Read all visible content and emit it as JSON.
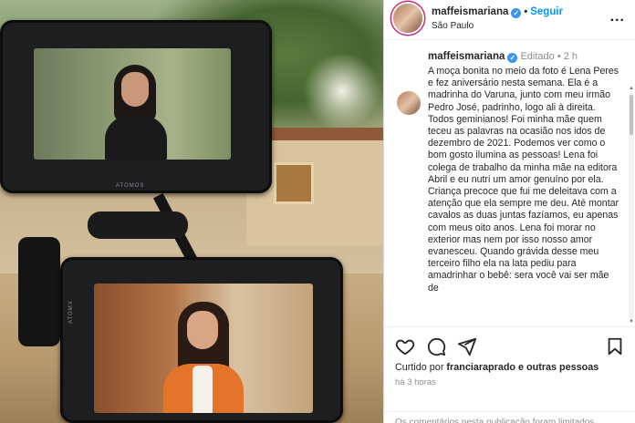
{
  "photo": {
    "monitor_brand_top": "ATOMOS",
    "monitor_brand_bottom": "ATOMX"
  },
  "header": {
    "username": "maffeismariana",
    "verified_icon": "verified-badge-icon",
    "separator": "•",
    "follow_label": "Seguir",
    "location": "São Paulo",
    "more_label": "..."
  },
  "post": {
    "username": "maffeismariana",
    "edited_label": "Editado",
    "separator": "•",
    "age": "2 h",
    "caption": "A moça bonita no meio da foto é Lena Peres e fez aniversário nesta semana. Ela é a madrinha do Varuna, junto com meu irmão Pedro José, padrinho, logo ali à direita. Todos geminianos! Foi minha mãe quem teceu as palavras na ocasião nos idos de dezembro de 2021. Podemos ver como o bom gosto ilumina as pessoas! Lena foi colega de trabalho da minha mãe na editora Abril e eu nutri um amor genuíno por ela. Criança precoce que fui me deleitava com a atenção que ela sempre me deu. Até montar cavalos as duas juntas fazíamos, eu apenas com meus oito anos. Lena foi morar no exterior mas nem por isso nosso amor evanesceu. Quando grávida desse meu terceiro filho ela na lata pediu para amadrinhar o bebê: sera você vai ser mãe de"
  },
  "actions": {
    "icons": [
      "heart-icon",
      "comment-icon",
      "share-icon",
      "bookmark-icon"
    ],
    "liked_prefix": "Curtido por",
    "liked_user": "franciaraprado",
    "liked_suffix": "e outras pessoas",
    "time": "há 3 horas",
    "comments_off": "Os comentários nesta publicação foram limitados"
  },
  "colors": {
    "follow_blue": "#0095f6",
    "verified_blue": "#3897f0",
    "text": "#262626",
    "muted": "#8e8e8e"
  }
}
